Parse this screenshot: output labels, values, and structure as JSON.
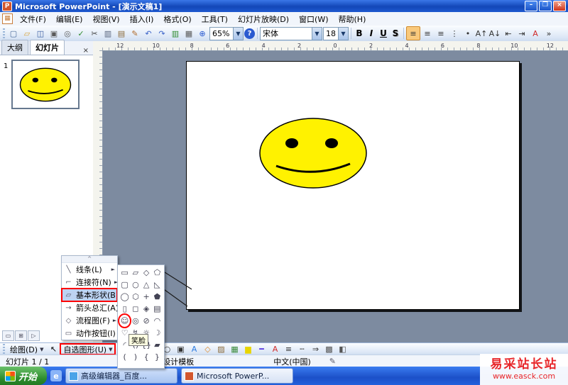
{
  "titlebar": {
    "icon_glyph": "P",
    "title": "Microsoft PowerPoint - [演示文稿1]",
    "minimize": "–",
    "restore": "❐",
    "close": "×"
  },
  "menubar": {
    "window_icon": "▦",
    "items": [
      "文件(F)",
      "编辑(E)",
      "视图(V)",
      "插入(I)",
      "格式(O)",
      "工具(T)",
      "幻灯片放映(D)",
      "窗口(W)",
      "帮助(H)"
    ]
  },
  "toolbar": {
    "dropdown_arrow": "▼",
    "std_icons": [
      {
        "n": "new-icon",
        "g": "▢",
        "c": "#4a6a9a"
      },
      {
        "n": "open-icon",
        "g": "▱",
        "c": "#d9a43c"
      },
      {
        "n": "save-icon",
        "g": "◫",
        "c": "#33579e"
      },
      {
        "n": "print-icon",
        "g": "▣",
        "c": "#5a5a5a"
      },
      {
        "n": "print-preview-icon",
        "g": "◎",
        "c": "#5a5a5a"
      },
      {
        "n": "spelling-icon",
        "g": "✓",
        "c": "#2d8a2d"
      },
      {
        "n": "cut-icon",
        "g": "✂",
        "c": "#444444"
      },
      {
        "n": "copy-icon",
        "g": "▥",
        "c": "#55617a"
      },
      {
        "n": "paste-icon",
        "g": "▤",
        "c": "#8a6a3a"
      },
      {
        "n": "format-painter-icon",
        "g": "✎",
        "c": "#b06a2a"
      },
      {
        "n": "undo-icon",
        "g": "↶",
        "c": "#3a62c8"
      },
      {
        "n": "redo-icon",
        "g": "↷",
        "c": "#3a62c8"
      },
      {
        "n": "chart-icon",
        "g": "▥",
        "c": "#2d8a2d"
      },
      {
        "n": "table-icon",
        "g": "▦",
        "c": "#5a5a5a"
      },
      {
        "n": "hyperlink-icon",
        "g": "⊕",
        "c": "#2a5ad0"
      }
    ],
    "zoom_value": "65%",
    "help_glyph": "?",
    "font_name": "宋体",
    "font_size": "18",
    "bold": "B",
    "italic": "I",
    "underline": "U",
    "shadow": "S",
    "fmt_icons": [
      {
        "n": "align-left-icon",
        "g": "≡",
        "c": "#333333"
      },
      {
        "n": "align-center-icon",
        "g": "≡",
        "c": "#333333"
      },
      {
        "n": "align-right-icon",
        "g": "≡",
        "c": "#333333"
      },
      {
        "n": "numbering-icon",
        "g": "⋮",
        "c": "#333333"
      },
      {
        "n": "bullets-icon",
        "g": "•",
        "c": "#333333"
      },
      {
        "n": "increase-font-icon",
        "g": "A↑",
        "c": "#333333"
      },
      {
        "n": "decrease-font-icon",
        "g": "A↓",
        "c": "#333333"
      },
      {
        "n": "decrease-indent-icon",
        "g": "⇤",
        "c": "#333333"
      },
      {
        "n": "increase-indent-icon",
        "g": "⇥",
        "c": "#333333"
      },
      {
        "n": "font-color-icon",
        "g": "A",
        "c": "#d02a2a"
      },
      {
        "n": "toolbar-options-icon",
        "g": "»",
        "c": "#333333"
      }
    ]
  },
  "panes": {
    "tabs": [
      {
        "label": "大纲"
      },
      {
        "label": "幻灯片"
      }
    ],
    "close": "×",
    "slide_number": "1",
    "view_buttons": [
      {
        "n": "normal-view-icon",
        "g": "▭"
      },
      {
        "n": "slide-sorter-view-icon",
        "g": "⊞"
      },
      {
        "n": "slideshow-view-icon",
        "g": "▷"
      }
    ]
  },
  "ruler": {
    "h_numbers": [
      "12",
      "10",
      "8",
      "6",
      "4",
      "2",
      "0",
      "2",
      "4",
      "6",
      "8",
      "10",
      "12"
    ]
  },
  "autoshapes_menu": {
    "chevron": "^",
    "items": [
      {
        "icon": "╲",
        "label": "线条(L)",
        "arrow": "►"
      },
      {
        "icon": "⌐",
        "label": "连接符(N)",
        "arrow": "►"
      },
      {
        "icon": "▱",
        "label": "基本形状(B)",
        "arrow": "►"
      },
      {
        "icon": "→",
        "label": "箭头总汇(A)",
        "arrow": "►"
      },
      {
        "icon": "◇",
        "label": "流程图(F)",
        "arrow": "►"
      },
      {
        "icon": "▭",
        "label": "动作按钮(I)",
        "arrow": "►"
      }
    ]
  },
  "shapes_palette": {
    "cells": [
      "▭",
      "▱",
      "◇",
      "⬠",
      "▢",
      "○",
      "△",
      "◺",
      "◯",
      "⬡",
      "+",
      "⬟",
      "▯",
      "◻",
      "◈",
      "▤",
      "☺",
      "◎",
      "⊘",
      "◠",
      "♡",
      "↯",
      "☼",
      "☽",
      "◜",
      "()",
      "{}",
      "▰",
      "(",
      ")",
      "{",
      "}"
    ],
    "highlight_index": 16,
    "tooltip": "笑脸"
  },
  "drawing_toolbar": {
    "draw_label": "绘图(D)",
    "draw_arrow": "▼",
    "select_glyph": "↖",
    "autoshapes_label": "自选图形(U)",
    "autoshapes_arrow": "▼",
    "icons": [
      {
        "n": "line-icon",
        "g": "╲",
        "c": "#333333"
      },
      {
        "n": "arrow-icon",
        "g": "↘",
        "c": "#333333"
      },
      {
        "n": "rectangle-icon",
        "g": "▭",
        "c": "#333333"
      },
      {
        "n": "oval-icon",
        "g": "○",
        "c": "#333333"
      },
      {
        "n": "text-box-icon",
        "g": "▣",
        "c": "#333333"
      },
      {
        "n": "wordart-icon",
        "g": "A",
        "c": "#2a7ae0"
      },
      {
        "n": "diagram-icon",
        "g": "◇",
        "c": "#e08a2a"
      },
      {
        "n": "clip-art-icon",
        "g": "▨",
        "c": "#8a6a3a"
      },
      {
        "n": "picture-icon",
        "g": "▦",
        "c": "#3a8a3a"
      },
      {
        "n": "fill-color-icon",
        "g": "▆",
        "c": "#e8d500"
      },
      {
        "n": "line-color-icon",
        "g": "━",
        "c": "#5a3ae0"
      },
      {
        "n": "font-color-icon",
        "g": "A",
        "c": "#d02a2a"
      },
      {
        "n": "line-style-icon",
        "g": "≡",
        "c": "#333333"
      },
      {
        "n": "dash-style-icon",
        "g": "╌",
        "c": "#333333"
      },
      {
        "n": "arrow-style-icon",
        "g": "⇒",
        "c": "#333333"
      },
      {
        "n": "shadow-style-icon",
        "g": "▩",
        "c": "#555555"
      },
      {
        "n": "3d-style-icon",
        "g": "◧",
        "c": "#555555"
      }
    ]
  },
  "status_bar": {
    "slide_indicator": "幻灯片 1 / 1",
    "template_name": "默认设计模板",
    "language": "中文(中国)",
    "spell_glyph": "✎"
  },
  "taskbar": {
    "start_label": "开始",
    "quick_glyph": "e",
    "tasks": [
      {
        "label": "高级编辑器_百度..."
      },
      {
        "label": "Microsoft PowerP..."
      }
    ]
  },
  "watermark": {
    "line1": "易采站长站",
    "line2": "www.easck.com"
  },
  "colors": {
    "annotation_red": "#ff0000",
    "smiley_fill": "#fff200",
    "taskbar_blue": "#2260dc",
    "start_green": "#2a8a2a"
  }
}
